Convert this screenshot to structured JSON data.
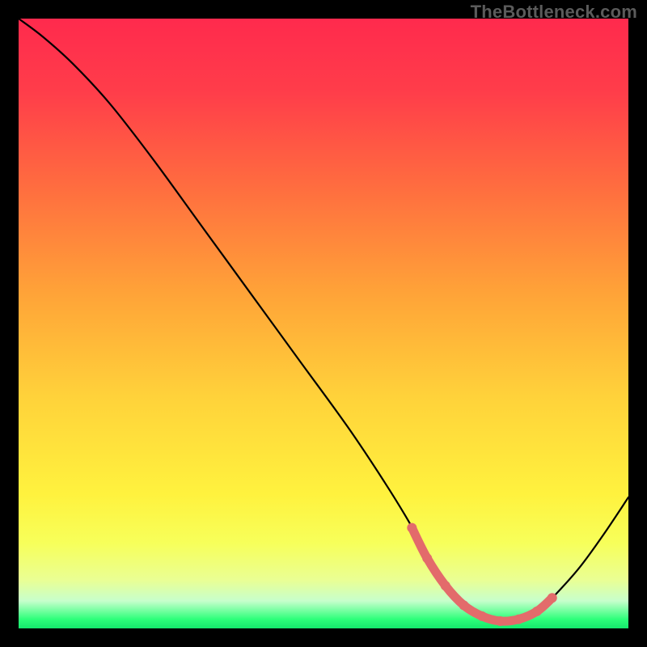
{
  "watermark": "TheBottleneck.com",
  "chart_data": {
    "type": "line",
    "title": "",
    "xlabel": "",
    "ylabel": "",
    "xlim": [
      0,
      100
    ],
    "ylim": [
      0,
      100
    ],
    "grid": false,
    "legend": false,
    "gradient_stops": [
      {
        "offset": 0.0,
        "color": "#ff2a4d"
      },
      {
        "offset": 0.12,
        "color": "#ff3d4a"
      },
      {
        "offset": 0.28,
        "color": "#ff6e3f"
      },
      {
        "offset": 0.45,
        "color": "#ffa338"
      },
      {
        "offset": 0.62,
        "color": "#ffd23a"
      },
      {
        "offset": 0.78,
        "color": "#fff23e"
      },
      {
        "offset": 0.86,
        "color": "#f7ff5a"
      },
      {
        "offset": 0.92,
        "color": "#eaff93"
      },
      {
        "offset": 0.955,
        "color": "#c7ffcc"
      },
      {
        "offset": 0.985,
        "color": "#2dff7a"
      },
      {
        "offset": 1.0,
        "color": "#15e86c"
      }
    ],
    "series": [
      {
        "name": "bottleneck-curve",
        "color": "#000000",
        "stroke_width": 2.2,
        "x": [
          0.0,
          4.0,
          9.0,
          15.0,
          22.0,
          30.0,
          38.0,
          46.0,
          54.0,
          60.0,
          64.0,
          67.0,
          70.0,
          73.0,
          76.0,
          79.0,
          82.0,
          85.0,
          88.0,
          92.0,
          96.0,
          100.0
        ],
        "y": [
          100.0,
          97.0,
          92.5,
          86.0,
          77.0,
          66.0,
          55.0,
          44.0,
          33.0,
          24.0,
          17.5,
          12.0,
          7.5,
          4.0,
          2.0,
          1.2,
          1.4,
          2.6,
          5.5,
          10.0,
          15.5,
          21.5
        ]
      },
      {
        "name": "valley-marker",
        "color": "#e36b6b",
        "stroke_width": 11,
        "linecap": "round",
        "markers": true,
        "x": [
          64.5,
          67.0,
          70.0,
          73.0,
          76.0,
          79.0,
          82.0,
          85.0,
          87.5
        ],
        "y": [
          16.5,
          11.5,
          7.0,
          3.8,
          2.0,
          1.2,
          1.5,
          2.8,
          5.0
        ]
      }
    ]
  }
}
